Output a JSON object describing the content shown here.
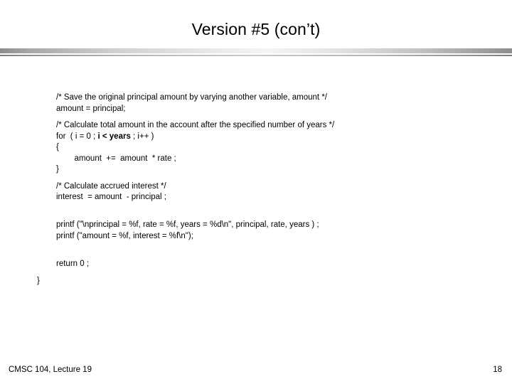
{
  "slide": {
    "title": "Version #5 (con’t)",
    "code": {
      "paragraphs": [
        {
          "lines": [
            {
              "text": "/* Save the original principal amount by varying another variable, amount */"
            },
            {
              "text": "amount = principal;"
            }
          ]
        },
        {
          "lines": [
            {
              "text": "/* Calculate total amount in the account after the specified number of years */"
            },
            {
              "pre": "for  ( i = 0 ; ",
              "bold": "i < years",
              "post": " ; i++ )"
            },
            {
              "text": "{"
            },
            {
              "text": "        amount  +=  amount  * rate ;"
            },
            {
              "text": "}"
            }
          ]
        },
        {
          "lines": [
            {
              "text": "/* Calculate accrued interest */"
            },
            {
              "text": "interest  = amount  - principal ;"
            }
          ]
        },
        {
          "lines": [
            {
              "text": ""
            },
            {
              "text": "printf (\"\\nprincipal = %f, rate = %f, years = %d\\n\", principal, rate, years ) ;"
            },
            {
              "text": "printf (\"amount = %f, interest = %f\\n\");"
            }
          ]
        },
        {
          "lines": [
            {
              "text": ""
            },
            {
              "text": "return 0 ;"
            }
          ]
        }
      ],
      "closing_brace": "}"
    },
    "footer": {
      "left": "CMSC 104, Lecture 19",
      "page_number": "18"
    }
  }
}
